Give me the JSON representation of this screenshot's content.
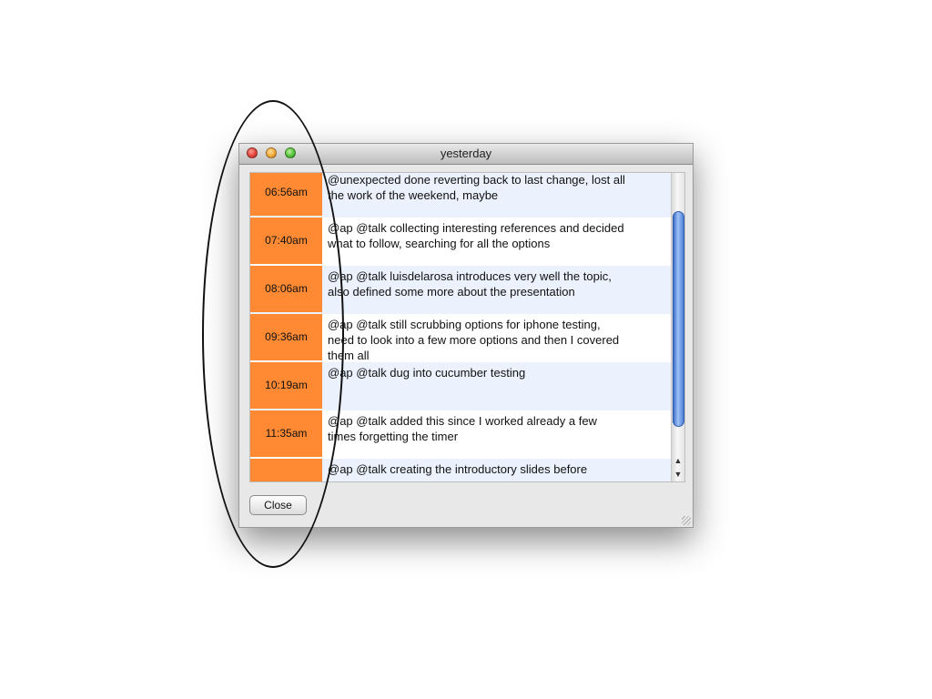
{
  "window": {
    "title": "yesterday"
  },
  "entries": [
    {
      "time": "06:56am",
      "text": "@unexpected done reverting back to last change, lost all the work of the weekend, maybe"
    },
    {
      "time": "07:40am",
      "text": "@ap @talk collecting interesting references and decided what to follow, searching for all the options"
    },
    {
      "time": "08:06am",
      "text": "@ap @talk luisdelarosa introduces very well the topic, also defined some more about the presentation"
    },
    {
      "time": "09:36am",
      "text": "@ap @talk still scrubbing options for iphone testing, need to look into a few more options and then I covered them all"
    },
    {
      "time": "10:19am",
      "text": "@ap @talk dug into cucumber testing"
    },
    {
      "time": "11:35am",
      "text": "@ap @talk added this since I worked already a few times forgetting the timer"
    },
    {
      "time": "",
      "text": "@ap @talk creating the introductory slides before"
    }
  ],
  "buttons": {
    "close": "Close"
  },
  "scrollbar": {
    "up_arrow": "▲",
    "down_arrow": "▼"
  },
  "colors": {
    "time_cell": "#ff8a33",
    "row_alt": "#ebf2fd",
    "scroll_thumb": "#4b7fd6"
  }
}
